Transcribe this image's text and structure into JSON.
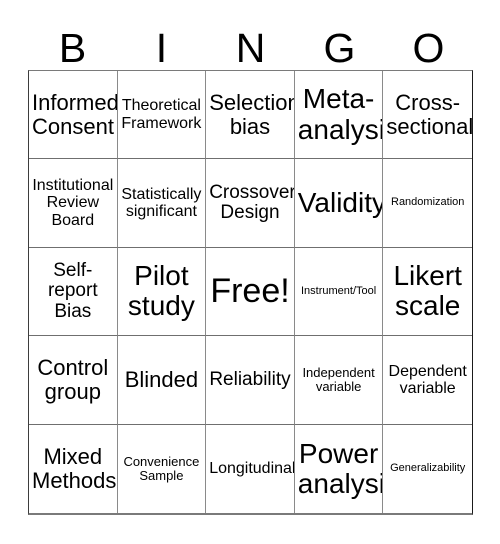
{
  "card": {
    "header_letters": [
      "B",
      "I",
      "N",
      "G",
      "O"
    ],
    "rows": [
      [
        {
          "text": "Informed\nConsent",
          "size": "lg"
        },
        {
          "text": "Theoretical\nFramework",
          "size": "sm"
        },
        {
          "text": "Selection\nbias",
          "size": "lg"
        },
        {
          "text": "Meta-\nanalysis",
          "size": "xl"
        },
        {
          "text": "Cross-\nsectional",
          "size": "lg"
        }
      ],
      [
        {
          "text": "Institutional\nReview\nBoard",
          "size": "sm"
        },
        {
          "text": "Statistically\nsignificant",
          "size": "sm"
        },
        {
          "text": "Crossover\nDesign",
          "size": "md"
        },
        {
          "text": "Validity",
          "size": "xl"
        },
        {
          "text": "Randomization",
          "size": "xxs"
        }
      ],
      [
        {
          "text": "Self-\nreport\nBias",
          "size": "md"
        },
        {
          "text": "Pilot\nstudy",
          "size": "xl"
        },
        {
          "text": "Free!",
          "size": "xxl"
        },
        {
          "text": "Instrument/Tool",
          "size": "xxs"
        },
        {
          "text": "Likert\nscale",
          "size": "xl"
        }
      ],
      [
        {
          "text": "Control\ngroup",
          "size": "lg"
        },
        {
          "text": "Blinded",
          "size": "lg"
        },
        {
          "text": "Reliability",
          "size": "md"
        },
        {
          "text": "Independent\nvariable",
          "size": "xs"
        },
        {
          "text": "Dependent\nvariable",
          "size": "sm"
        }
      ],
      [
        {
          "text": "Mixed\nMethods",
          "size": "lg"
        },
        {
          "text": "Convenience\nSample",
          "size": "xs"
        },
        {
          "text": "Longitudinal",
          "size": "sm"
        },
        {
          "text": "Power\nanalysis",
          "size": "xl"
        },
        {
          "text": "Generalizability",
          "size": "xxs"
        }
      ]
    ]
  }
}
